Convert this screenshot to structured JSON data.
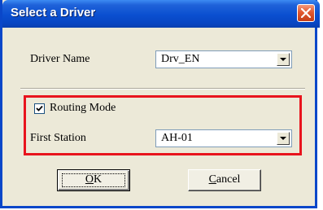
{
  "window": {
    "title": "Select a Driver"
  },
  "driver": {
    "label": "Driver Name",
    "value": "Drv_EN"
  },
  "routing": {
    "label": "Routing Mode",
    "checked": true
  },
  "station": {
    "label": "First Station",
    "value": "AH-01"
  },
  "buttons": {
    "ok_mnemonic": "O",
    "ok_rest": "K",
    "cancel_mnemonic": "C",
    "cancel_rest": "ancel"
  },
  "colors": {
    "highlight": "#e8141d",
    "titlebar": "#0a4fd0"
  }
}
